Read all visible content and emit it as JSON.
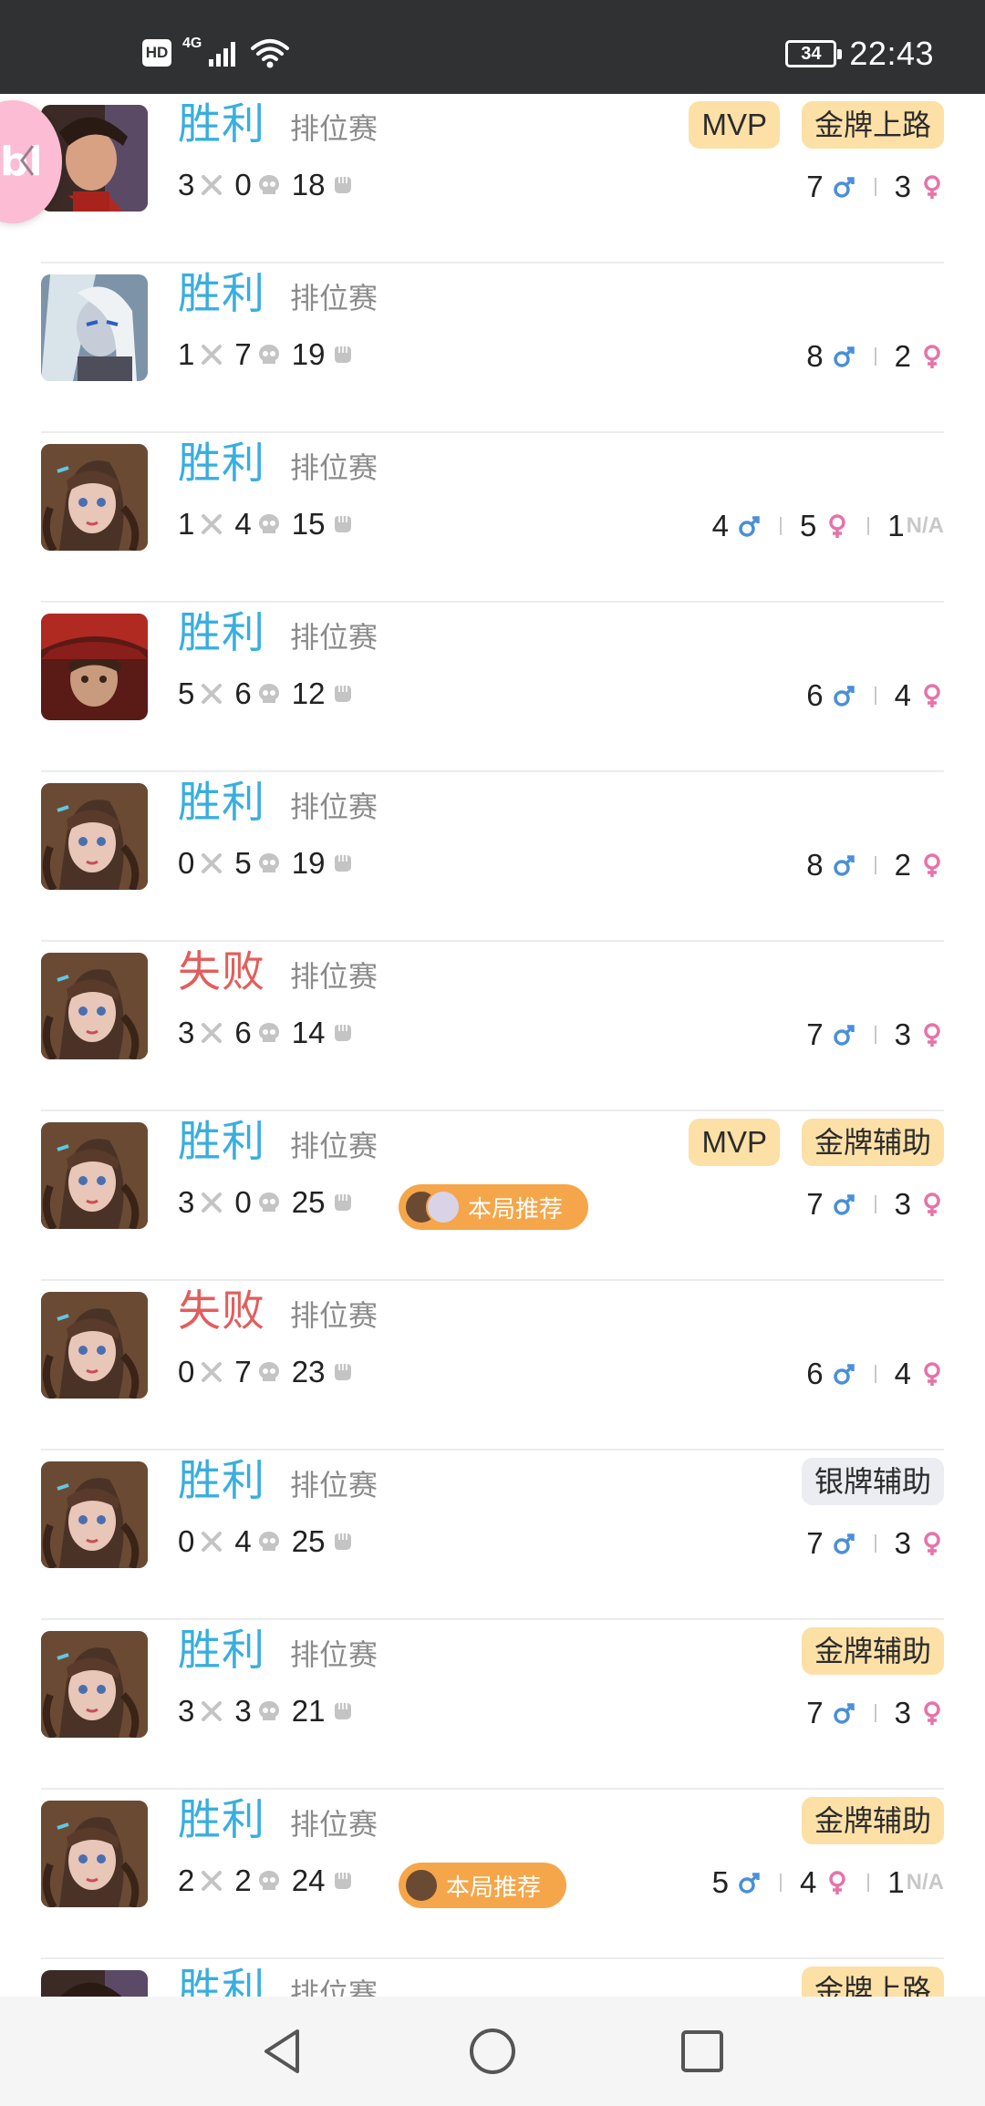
{
  "status_bar": {
    "hd": "HD",
    "network": "4G",
    "battery": "34",
    "time": "22:43"
  },
  "floating_bubble": {
    "text": "bl"
  },
  "matches": [
    {
      "result": "胜利",
      "outcome": "win",
      "mode": "排位赛",
      "kills": "3",
      "deaths": "0",
      "assists": "18",
      "hero": "hero-a",
      "badges": [
        {
          "label": "MVP",
          "kind": "mvp"
        },
        {
          "label": "金牌上路",
          "kind": "gold"
        }
      ],
      "male": "7",
      "female": "3",
      "na": null,
      "recommend": null
    },
    {
      "result": "胜利",
      "outcome": "win",
      "mode": "排位赛",
      "kills": "1",
      "deaths": "7",
      "assists": "19",
      "hero": "hero-b",
      "badges": [],
      "male": "8",
      "female": "2",
      "na": null,
      "recommend": null
    },
    {
      "result": "胜利",
      "outcome": "win",
      "mode": "排位赛",
      "kills": "1",
      "deaths": "4",
      "assists": "15",
      "hero": "hero-c",
      "badges": [],
      "male": "4",
      "female": "5",
      "na": {
        "count": "1",
        "label": "N/A"
      },
      "recommend": null
    },
    {
      "result": "胜利",
      "outcome": "win",
      "mode": "排位赛",
      "kills": "5",
      "deaths": "6",
      "assists": "12",
      "hero": "hero-d",
      "badges": [],
      "male": "6",
      "female": "4",
      "na": null,
      "recommend": null
    },
    {
      "result": "胜利",
      "outcome": "win",
      "mode": "排位赛",
      "kills": "0",
      "deaths": "5",
      "assists": "19",
      "hero": "hero-c",
      "badges": [],
      "male": "8",
      "female": "2",
      "na": null,
      "recommend": null
    },
    {
      "result": "失败",
      "outcome": "loss",
      "mode": "排位赛",
      "kills": "3",
      "deaths": "6",
      "assists": "14",
      "hero": "hero-c",
      "badges": [],
      "male": "7",
      "female": "3",
      "na": null,
      "recommend": null
    },
    {
      "result": "胜利",
      "outcome": "win",
      "mode": "排位赛",
      "kills": "3",
      "deaths": "0",
      "assists": "25",
      "hero": "hero-c",
      "badges": [
        {
          "label": "MVP",
          "kind": "mvp"
        },
        {
          "label": "金牌辅助",
          "kind": "gold"
        }
      ],
      "male": "7",
      "female": "3",
      "na": null,
      "recommend": {
        "label": "本局推荐",
        "avatars": 2
      }
    },
    {
      "result": "失败",
      "outcome": "loss",
      "mode": "排位赛",
      "kills": "0",
      "deaths": "7",
      "assists": "23",
      "hero": "hero-c",
      "badges": [],
      "male": "6",
      "female": "4",
      "na": null,
      "recommend": null
    },
    {
      "result": "胜利",
      "outcome": "win",
      "mode": "排位赛",
      "kills": "0",
      "deaths": "4",
      "assists": "25",
      "hero": "hero-c",
      "badges": [
        {
          "label": "银牌辅助",
          "kind": "silver"
        }
      ],
      "male": "7",
      "female": "3",
      "na": null,
      "recommend": null
    },
    {
      "result": "胜利",
      "outcome": "win",
      "mode": "排位赛",
      "kills": "3",
      "deaths": "3",
      "assists": "21",
      "hero": "hero-c",
      "badges": [
        {
          "label": "金牌辅助",
          "kind": "gold"
        }
      ],
      "male": "7",
      "female": "3",
      "na": null,
      "recommend": null
    },
    {
      "result": "胜利",
      "outcome": "win",
      "mode": "排位赛",
      "kills": "2",
      "deaths": "2",
      "assists": "24",
      "hero": "hero-c",
      "badges": [
        {
          "label": "金牌辅助",
          "kind": "gold"
        }
      ],
      "male": "5",
      "female": "4",
      "na": {
        "count": "1",
        "label": "N/A"
      },
      "recommend": {
        "label": "本局推荐",
        "avatars": 1
      }
    },
    {
      "result": "胜利",
      "outcome": "win",
      "mode": "排位赛",
      "kills": "",
      "deaths": "",
      "assists": "",
      "hero": "hero-a",
      "badges": [
        {
          "label": "金牌上路",
          "kind": "gold"
        }
      ],
      "male": "",
      "female": "",
      "na": null,
      "recommend": null
    }
  ],
  "colors": {
    "win": "#38aee0",
    "loss": "#e35d5d",
    "gold_badge": "#fce0a6",
    "silver_badge": "#ecedf2",
    "recommend": "#f5a64a",
    "male": "#4a8fd8",
    "female": "#e773a8"
  },
  "icons": {
    "kill": "crossed-swords-icon",
    "death": "skull-icon",
    "assist": "fist-icon",
    "male": "male-symbol-icon",
    "female": "female-symbol-icon"
  },
  "nav_bar": {
    "buttons": [
      "back",
      "home",
      "recents"
    ]
  }
}
